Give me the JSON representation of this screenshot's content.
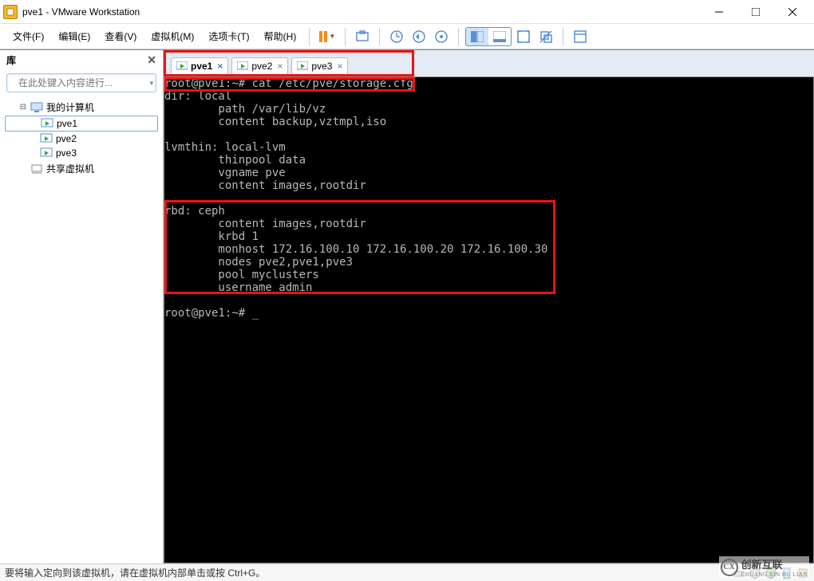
{
  "window": {
    "title": "pve1 - VMware Workstation"
  },
  "menus": {
    "file": "文件(F)",
    "edit": "编辑(E)",
    "view": "查看(V)",
    "vm": "虚拟机(M)",
    "tabs": "选项卡(T)",
    "help": "帮助(H)"
  },
  "sidebar": {
    "header": "库",
    "search_placeholder": "在此处键入内容进行...",
    "root": "我的计算机",
    "nodes": [
      "pve1",
      "pve2",
      "pve3"
    ],
    "shared": "共享虚拟机"
  },
  "tabs": [
    {
      "label": "pve1",
      "active": true
    },
    {
      "label": "pve2",
      "active": false
    },
    {
      "label": "pve3",
      "active": false
    }
  ],
  "terminal": {
    "prompt1": "root@pve1:~# cat /etc/pve/storage.cfg",
    "lines": [
      "dir: local",
      "        path /var/lib/vz",
      "        content backup,vztmpl,iso",
      "",
      "lvmthin: local-lvm",
      "        thinpool data",
      "        vgname pve",
      "        content images,rootdir",
      "",
      "rbd: ceph",
      "        content images,rootdir",
      "        krbd 1",
      "        monhost 172.16.100.10 172.16.100.20 172.16.100.30",
      "        nodes pve2,pve1,pve3",
      "        pool myclusters",
      "        username admin",
      "",
      "root@pve1:~# _"
    ]
  },
  "statusbar": {
    "text": "要将输入定向到该虚拟机，请在虚拟机内部单击或按 Ctrl+G。"
  },
  "watermark": {
    "brand_cn": "创新互联",
    "brand_en": "CHUANG XIN HU LIAN",
    "logo": "CX"
  }
}
